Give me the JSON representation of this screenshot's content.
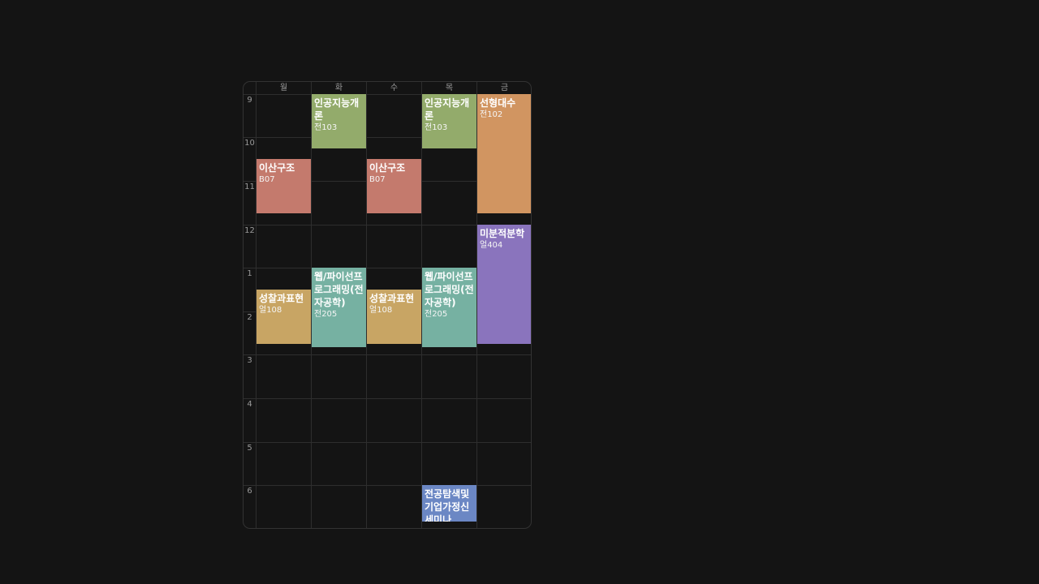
{
  "days": [
    "월",
    "화",
    "수",
    "목",
    "금"
  ],
  "hours": [
    "9",
    "10",
    "11",
    "12",
    "1",
    "2",
    "3",
    "4",
    "5",
    "6"
  ],
  "courses": [
    {
      "id": "c1",
      "name": "인공지능개론",
      "room": "전103",
      "color": "#93ab6b"
    },
    {
      "id": "c2",
      "name": "인공지능개론",
      "room": "전103",
      "color": "#93ab6b"
    },
    {
      "id": "c3",
      "name": "선형대수",
      "room": "전102",
      "color": "#d19561"
    },
    {
      "id": "c4",
      "name": "이산구조",
      "room": "B07",
      "color": "#c47a6d"
    },
    {
      "id": "c5",
      "name": "이산구조",
      "room": "B07",
      "color": "#c47a6d"
    },
    {
      "id": "c6",
      "name": "미분적분학",
      "room": "얼404",
      "color": "#8a74bd"
    },
    {
      "id": "c7",
      "name": "성찰과표현",
      "room": "얼108",
      "color": "#c8a564"
    },
    {
      "id": "c8",
      "name": "웹/파이선프로그래밍(전자공학)",
      "room": "전205",
      "color": "#76b1a2"
    },
    {
      "id": "c9",
      "name": "성찰과표현",
      "room": "얼108",
      "color": "#c8a564"
    },
    {
      "id": "c10",
      "name": "웹/파이선프로그래밍(전자공학)",
      "room": "전205",
      "color": "#76b1a2"
    },
    {
      "id": "c11",
      "name": "전공탐색및기업가정신세미나",
      "room": "",
      "color": "#6b87c4"
    }
  ]
}
